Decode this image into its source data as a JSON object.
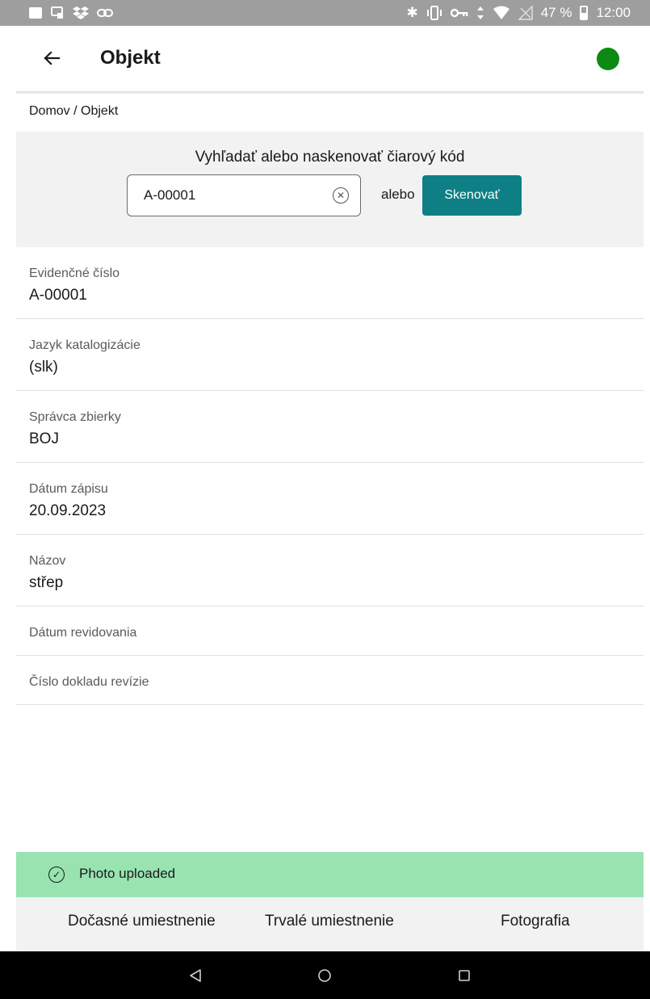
{
  "status_bar": {
    "battery": "47 %",
    "time": "12:00",
    "icons_left": [
      "image-icon",
      "screencast-icon",
      "dropbox-icon",
      "link-icon"
    ],
    "icons_right": [
      "bluetooth-icon",
      "vibrate-icon",
      "vpn-key-icon",
      "data-arrows-icon",
      "wifi-icon",
      "no-signal-icon",
      "battery-icon"
    ]
  },
  "app_bar": {
    "title": "Objekt",
    "status_color": "#0c8a12"
  },
  "breadcrumb": "Domov / Objekt",
  "search": {
    "title": "Vyhľadať alebo naskenovať čiarový kód",
    "value": "A-00001",
    "or_label": "alebo",
    "scan_label": "Skenovať",
    "accent": "#0e8085"
  },
  "fields": [
    {
      "label": "Evidenčné číslo",
      "value": "A-00001"
    },
    {
      "label": "Jazyk katalogizácie",
      "value": "(slk)"
    },
    {
      "label": "Správca zbierky",
      "value": "BOJ"
    },
    {
      "label": "Dátum zápisu",
      "value": "20.09.2023"
    },
    {
      "label": "Názov",
      "value": "střep"
    },
    {
      "label": "Dátum revidovania"
    },
    {
      "label": "Číslo dokladu revízie"
    }
  ],
  "toast": {
    "text": "Photo uploaded",
    "color": "#98e3b0"
  },
  "tabs": [
    {
      "label": "Dočasné umiestnenie"
    },
    {
      "label": "Trvalé umiestnenie"
    },
    {
      "label": "Fotografia"
    }
  ]
}
